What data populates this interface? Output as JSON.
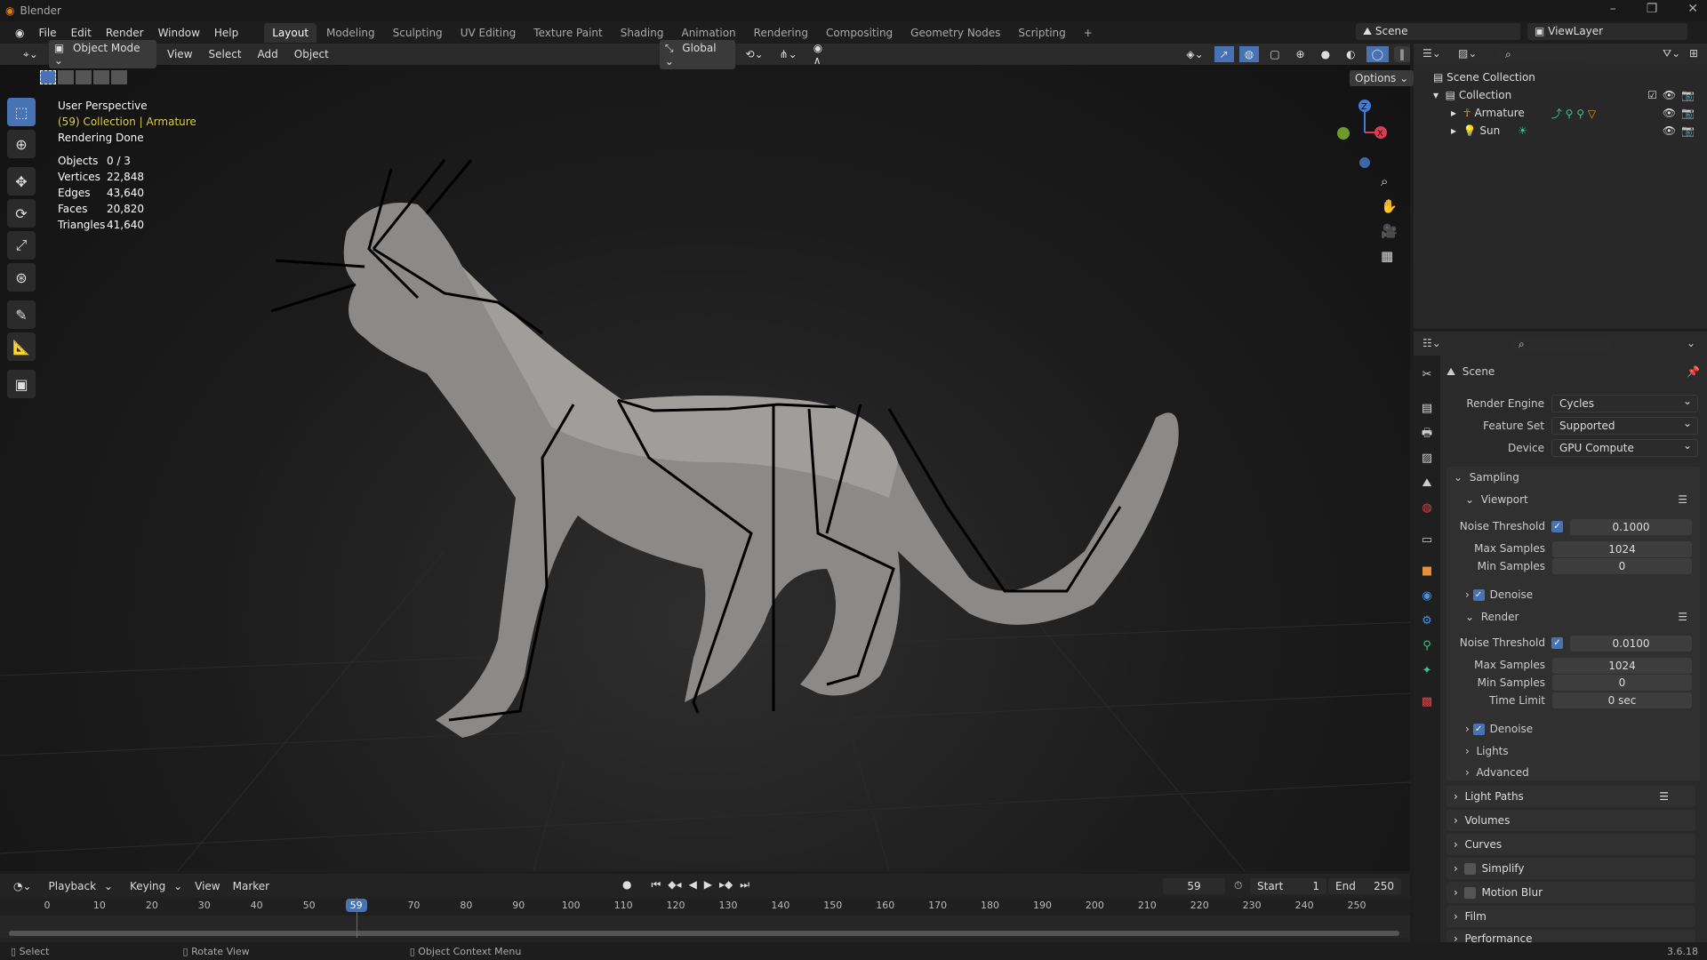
{
  "app": {
    "title": "Blender",
    "version": "3.6.18"
  },
  "menu": [
    "File",
    "Edit",
    "Render",
    "Window",
    "Help"
  ],
  "workspaces": [
    "Layout",
    "Modeling",
    "Sculpting",
    "UV Editing",
    "Texture Paint",
    "Shading",
    "Animation",
    "Rendering",
    "Compositing",
    "Geometry Nodes",
    "Scripting"
  ],
  "workspace_add": "+",
  "scene_selector": {
    "scene": "Scene",
    "view_layer": "ViewLayer"
  },
  "viewport_header": {
    "mode": "Object Mode",
    "menus": [
      "View",
      "Select",
      "Add",
      "Object"
    ],
    "orientation": "Global",
    "options": "Options"
  },
  "overlay": {
    "view": "User Perspective",
    "context": "(59) Collection | Armature",
    "status": "Rendering Done"
  },
  "stats": [
    {
      "k": "Objects",
      "v": "0 / 3"
    },
    {
      "k": "Vertices",
      "v": "22,848"
    },
    {
      "k": "Edges",
      "v": "43,640"
    },
    {
      "k": "Faces",
      "v": "20,820"
    },
    {
      "k": "Triangles",
      "v": "41,640"
    }
  ],
  "gizmo": {
    "z": "Z",
    "x": "X"
  },
  "outliner": {
    "root": "Scene Collection",
    "collection": "Collection",
    "items": [
      "Armature",
      "Sun"
    ]
  },
  "properties": {
    "header": "Scene",
    "render_engine": {
      "label": "Render Engine",
      "value": "Cycles"
    },
    "feature_set": {
      "label": "Feature Set",
      "value": "Supported"
    },
    "device": {
      "label": "Device",
      "value": "GPU Compute"
    },
    "sampling": "Sampling",
    "viewport": {
      "title": "Viewport",
      "noise_label": "Noise Threshold",
      "noise": "0.1000",
      "max_label": "Max Samples",
      "max": "1024",
      "min_label": "Min Samples",
      "min": "0",
      "denoise": "Denoise"
    },
    "render": {
      "title": "Render",
      "noise_label": "Noise Threshold",
      "noise": "0.0100",
      "max_label": "Max Samples",
      "max": "1024",
      "min_label": "Min Samples",
      "min": "0",
      "time_label": "Time Limit",
      "time": "0 sec",
      "denoise": "Denoise"
    },
    "sub": [
      "Lights",
      "Advanced"
    ],
    "panels": [
      "Light Paths",
      "Volumes",
      "Curves",
      "Simplify",
      "Motion Blur",
      "Film",
      "Performance"
    ]
  },
  "timeline": {
    "menus": [
      "Playback",
      "Keying",
      "View",
      "Marker"
    ],
    "current": "59",
    "start_label": "Start",
    "start": "1",
    "end_label": "End",
    "end": "250",
    "ticks": [
      0,
      10,
      20,
      30,
      40,
      50,
      60,
      70,
      80,
      90,
      100,
      110,
      120,
      130,
      140,
      150,
      160,
      170,
      180,
      190,
      200,
      210,
      220,
      230,
      240,
      250
    ]
  },
  "statusbar": {
    "select": "Select",
    "rotate": "Rotate View",
    "context": "Object Context Menu"
  },
  "colors": {
    "accent": "#4772b3",
    "overlay_yellow": "#e0d44a"
  }
}
